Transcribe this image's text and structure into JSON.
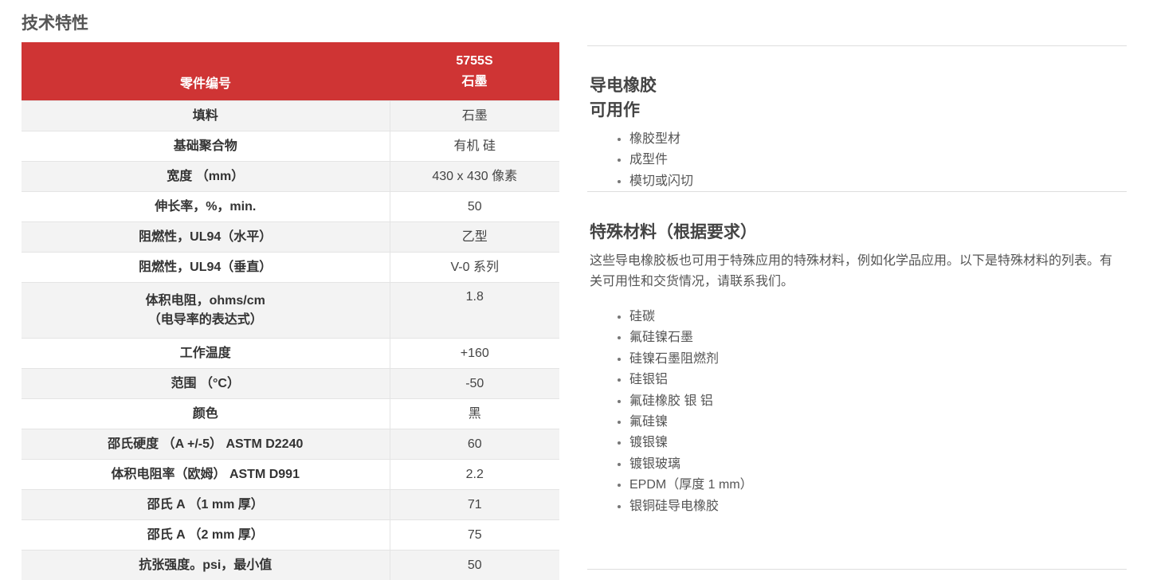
{
  "section_title": "技术特性",
  "table": {
    "header": {
      "label": "零件编号",
      "part_number": "5755S",
      "part_material": "石墨"
    },
    "rows": [
      {
        "label": "填料",
        "value": "石墨"
      },
      {
        "label": "基础聚合物",
        "value": "有机 硅"
      },
      {
        "label": "宽度 （mm）",
        "value": "430 x 430 像素"
      },
      {
        "label": "伸长率，%，min.",
        "value": "50"
      },
      {
        "label": "阻燃性，UL94（水平）",
        "value": "乙型"
      },
      {
        "label": "阻燃性，UL94（垂直）",
        "value": "V-0 系列"
      },
      {
        "label": "体积电阻，ohms/cm",
        "label_line2": "（电导率的表达式）",
        "value": "1.8"
      },
      {
        "label": "工作温度",
        "value": "+160"
      },
      {
        "label": "范围 （°C）",
        "value": "-50"
      },
      {
        "label": "颜色",
        "value": "黑"
      },
      {
        "label": "邵氏硬度 （A +/-5） ASTM D2240",
        "value": "60"
      },
      {
        "label": "体积电阻率（欧姆） ASTM D991",
        "value": "2.2"
      },
      {
        "label": "邵氏 A （1 mm 厚）",
        "value": "71"
      },
      {
        "label": "邵氏 A （2 mm 厚）",
        "value": "75"
      },
      {
        "label": "抗张强度。psi，最小值",
        "value": "50"
      }
    ]
  },
  "side": {
    "block1": {
      "title_line1": "导电橡胶",
      "title_line2": "可用作",
      "items": [
        "橡胶型材",
        "成型件",
        "模切或闪切"
      ]
    },
    "block2": {
      "title": "特殊材料（根据要求）",
      "description": "这些导电橡胶板也可用于特殊应用的特殊材料，例如化学品应用。以下是特殊材料的列表。有关可用性和交货情况，请联系我们。",
      "items": [
        "硅碳",
        "氟硅镍石墨",
        "硅镍石墨阻燃剂",
        "硅银铝",
        "氟硅橡胶 银 铝",
        "氟硅镍",
        "镀银镍",
        "镀银玻璃",
        "EPDM（厚度 1 mm）",
        "银铜硅导电橡胶"
      ]
    }
  },
  "colors": {
    "header_red": "#cf3434",
    "row_stripe": "#f3f3f3"
  }
}
